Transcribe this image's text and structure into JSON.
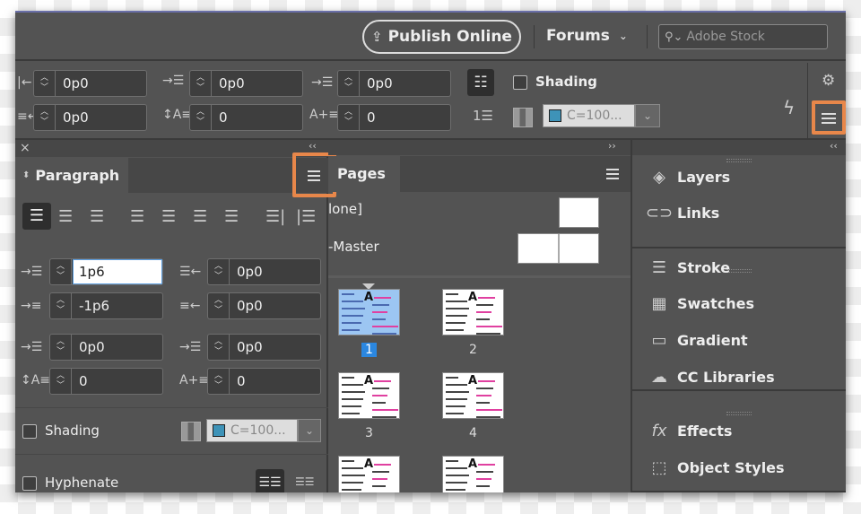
{
  "topbar": {
    "publish_label": "Publish Online",
    "forums_label": "Forums",
    "search_placeholder": "Adobe Stock"
  },
  "controlbar": {
    "left_indent": "0p0",
    "right_indent": "0p0",
    "space_before": "0p0",
    "space_after": "0p0",
    "drop_cap_lines": "0",
    "drop_cap_chars": "0",
    "shading_label": "Shading",
    "shading_color": "C=100..."
  },
  "paragraph_panel": {
    "title": "Paragraph",
    "left_indent": "1p6",
    "right_indent": "0p0",
    "first_line_indent": "-1p6",
    "last_line_indent": "0p0",
    "space_before": "0p0",
    "space_after": "0p0",
    "drop_cap_lines": "0",
    "drop_cap_chars": "0",
    "shading_label": "Shading",
    "shading_color": "C=100...",
    "hyphenate_label": "Hyphenate"
  },
  "pages_panel": {
    "title": "Pages",
    "masters": [
      "[None]",
      "A-Master"
    ],
    "masters_visible": [
      "lone]",
      "-Master"
    ],
    "pages": [
      "1",
      "2",
      "3",
      "4"
    ],
    "selected_page": "1",
    "master_letter": "A"
  },
  "dock": {
    "items": [
      {
        "label": "Layers",
        "icon": "layers-icon"
      },
      {
        "label": "Links",
        "icon": "links-icon"
      },
      {
        "label": "Stroke",
        "icon": "stroke-icon"
      },
      {
        "label": "Swatches",
        "icon": "swatches-icon"
      },
      {
        "label": "Gradient",
        "icon": "gradient-icon"
      },
      {
        "label": "CC Libraries",
        "icon": "cc-libraries-icon"
      },
      {
        "label": "Effects",
        "icon": "fx-icon"
      },
      {
        "label": "Object Styles",
        "icon": "object-styles-icon"
      }
    ]
  },
  "colors": {
    "highlight": "#e8874a",
    "selection": "#2b87e0",
    "swatch": "#3e93b8"
  }
}
